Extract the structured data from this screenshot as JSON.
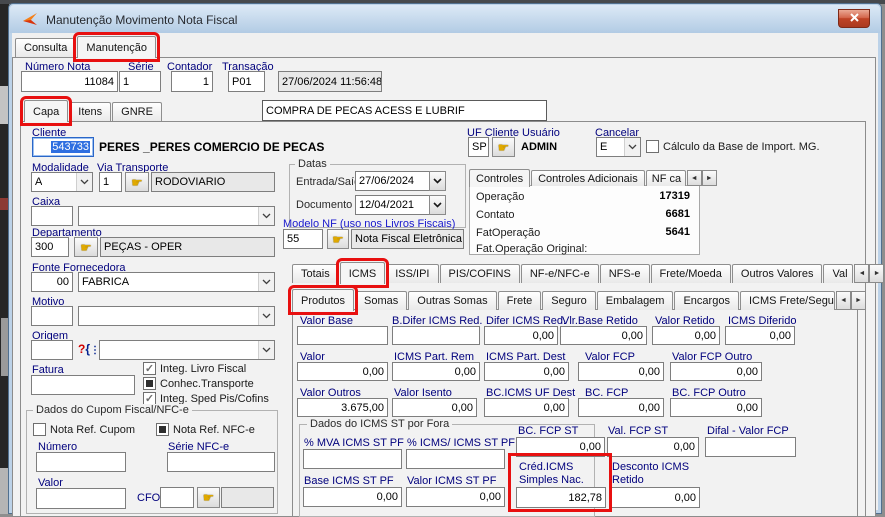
{
  "window": {
    "title": "Manutenção Movimento Nota Fiscal"
  },
  "main_tabs": {
    "items": [
      "Consulta",
      "Manutenção"
    ],
    "active": "Manutenção"
  },
  "header": {
    "numero_nota": {
      "label": "Número Nota",
      "value": "11084"
    },
    "serie": {
      "label": "Série",
      "value": "1"
    },
    "contador": {
      "label": "Contador",
      "value": "1"
    },
    "transacao": {
      "label": "Transação",
      "value": "P01"
    },
    "timestamp": "27/06/2024 11:56:48",
    "descricao": "COMPRA DE PECAS ACESS E LUBRIF"
  },
  "capa_tabs": {
    "items": [
      "Capa",
      "Itens",
      "GNRE"
    ],
    "active": "Capa"
  },
  "capa": {
    "cliente": {
      "label": "Cliente",
      "code": "543733",
      "name": "PERES _PERES COMERCIO DE PECAS"
    },
    "modalidade": {
      "label": "Modalidade",
      "value": "A"
    },
    "via_transporte": {
      "label": "Via Transporte",
      "code": "1",
      "name": "RODOVIARIO"
    },
    "caixa": {
      "label": "Caixa",
      "code": "",
      "name": ""
    },
    "departamento": {
      "label": "Departamento",
      "code": "300",
      "name": "PEÇAS - OPER"
    },
    "fonte_fornecedora": {
      "label": "Fonte Fornecedora",
      "code": "00",
      "name": "FABRICA"
    },
    "motivo": {
      "label": "Motivo",
      "code": "",
      "name": ""
    },
    "origem": {
      "label": "Origem",
      "code": "",
      "name": ""
    },
    "fatura": {
      "label": "Fatura",
      "value": ""
    },
    "integ_checks": [
      {
        "label": "Integ. Livro Fiscal",
        "state": "checked"
      },
      {
        "label": "Conhec.Transporte",
        "state": "square"
      },
      {
        "label": "Integ. Sped Pis/Cofins",
        "state": "checked"
      }
    ],
    "cupom": {
      "title": "Dados do Cupom Fiscal/NFC-e",
      "nota_ref_cupom": {
        "label": "Nota Ref. Cupom",
        "state": "unchecked"
      },
      "nota_ref_nfce": {
        "label": "Nota Ref. NFC-e",
        "state": "square"
      },
      "numero": {
        "label": "Número",
        "value": ""
      },
      "serie_nfce": {
        "label": "Série NFC-e",
        "value": ""
      },
      "valor": {
        "label": "Valor",
        "value": ""
      },
      "cfo": {
        "label": "CFO",
        "value": "",
        "name": ""
      }
    },
    "datas": {
      "title": "Datas",
      "entrada_saida": {
        "label": "Entrada/Saída",
        "value": "27/06/2024"
      },
      "documento": {
        "label": "Documento",
        "value": "12/04/2021"
      }
    },
    "modelo_nf": {
      "label": "Modelo NF (uso nos Livros Fiscais)",
      "code": "55",
      "name": "Nota Fiscal Eletrônica"
    },
    "uf_cliente": {
      "label": "UF Cliente Usuário",
      "uf": "SP",
      "usuario": "ADMIN"
    },
    "cancelar": {
      "label": "Cancelar",
      "value": "E"
    },
    "calculo_base": {
      "label": "Cálculo da Base de Import. MG."
    },
    "controles": {
      "tabs": [
        "Controles",
        "Controles Adicionais",
        "NF ca"
      ],
      "rows": [
        {
          "label": "Operação",
          "value": "17319"
        },
        {
          "label": "Contato",
          "value": "6681"
        },
        {
          "label": "FatOperação",
          "value": "5641"
        },
        {
          "label": "Fat.Operação Original:",
          "value": ""
        }
      ]
    }
  },
  "detail_tabs": {
    "items": [
      "Totais",
      "ICMS",
      "ISS/IPI",
      "PIS/COFINS",
      "NF-e/NFC-e",
      "NFS-e",
      "Frete/Moeda",
      "Outros Valores",
      "Val"
    ],
    "active": "ICMS"
  },
  "sub_tabs": {
    "items": [
      "Produtos",
      "Somas",
      "Outras Somas",
      "Frete",
      "Seguro",
      "Embalagem",
      "Encargos",
      "ICMS Frete/Seguro"
    ],
    "active": "Produtos"
  },
  "icms": {
    "fields": [
      {
        "label": "Valor Base",
        "value": ""
      },
      {
        "label": "B.Difer ICMS Red.",
        "value": ""
      },
      {
        "label": "Difer ICMS Red.",
        "value": "0,00"
      },
      {
        "label": "Vlr.Base Retido",
        "value": "0,00"
      },
      {
        "label": "Valor Retido",
        "value": "0,00"
      },
      {
        "label": "ICMS Diferido",
        "value": "0,00"
      },
      {
        "label": "Valor",
        "value": "0,00"
      },
      {
        "label": "ICMS Part. Rem",
        "value": "0,00"
      },
      {
        "label": "ICMS Part. Dest",
        "value": "0,00"
      },
      {
        "label": "Valor FCP",
        "value": "0,00"
      },
      {
        "label": "Valor FCP Outro",
        "value": "0,00"
      },
      {
        "label": "Valor Outros",
        "value": "3.675,00"
      },
      {
        "label": "Valor Isento",
        "value": "0,00"
      },
      {
        "label": "BC.ICMS UF Dest",
        "value": "0,00"
      },
      {
        "label": "BC. FCP",
        "value": "0,00"
      },
      {
        "label": "BC. FCP Outro",
        "value": "0,00"
      }
    ],
    "st_group": {
      "title": "Dados do ICMS ST por Fora",
      "fields": [
        {
          "label": "% MVA ICMS ST PF",
          "value": ""
        },
        {
          "label": "% ICMS/ ICMS ST PF",
          "value": ""
        },
        {
          "label": "Base ICMS ST PF",
          "value": "0,00"
        },
        {
          "label": "Valor ICMS ST PF",
          "value": "0,00"
        }
      ]
    },
    "fcp_st": {
      "label": "BC. FCP ST",
      "value": "0,00"
    },
    "val_fcp_st": {
      "label": "Val. FCP ST",
      "value": "0,00"
    },
    "difal_fcp": {
      "label": "Difal - Valor FCP",
      "value": ""
    },
    "cred_icms": {
      "label1": "Créd.ICMS",
      "label2": "Simples Nac.",
      "value": "182,78"
    },
    "desconto": {
      "label1": "Desconto ICMS",
      "label2": "Retido",
      "value": "0,00"
    }
  },
  "icons": {
    "hand": "☛",
    "check": "✓",
    "dots": "⋮",
    "question": "?",
    "brace": "{",
    "scroll_left": "◄",
    "scroll_right": "►"
  },
  "colors": {
    "annotation_red": "#e81010",
    "label_navy": "#00007d",
    "selection_blue": "#2f6fe0",
    "titlebar_top": "#d8e6f4",
    "titlebar_bottom": "#b0c9e2",
    "close_red": "#c0452d"
  }
}
